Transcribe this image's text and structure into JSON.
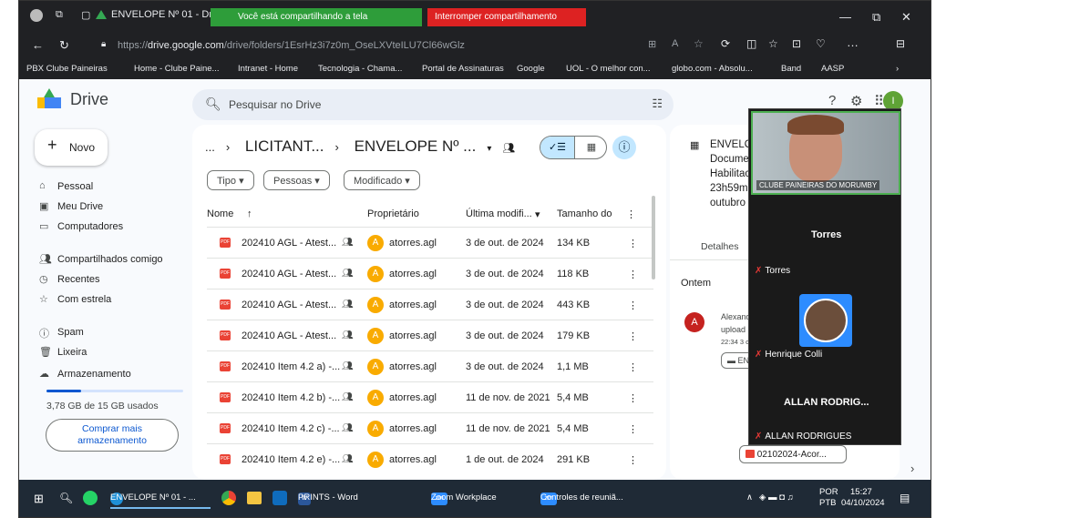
{
  "browser": {
    "tab_title": "ENVELOPE Nº 01 - Dr",
    "share_notice": "Você está compartilhando a tela",
    "stop_share": "Interromper compartilhamento",
    "url_prefix": "https://",
    "url_host": "drive.google.com",
    "url_path": "/drive/folders/1EsrHz3i7z0m_OseLXVteILU7Cl66wGlz",
    "bookmarks": [
      "PBX Clube Paineiras",
      "Home - Clube Paine...",
      "Intranet - Home",
      "Tecnologia - Chama...",
      "Portal de Assinaturas",
      "Google",
      "UOL - O melhor con...",
      "globo.com - Absolu...",
      "Band",
      "AASP"
    ]
  },
  "drive": {
    "app_name": "Drive",
    "search_placeholder": "Pesquisar no Drive",
    "account_initial": "I",
    "new_label": "Novo",
    "nav": [
      "Pessoal",
      "Meu Drive",
      "Computadores",
      "Compartilhados comigo",
      "Recentes",
      "Com estrela",
      "Spam",
      "Lixeira",
      "Armazenamento"
    ],
    "storage_used": 0.25,
    "storage_text": "3,78 GB de 15 GB usados",
    "buy_storage": "Comprar mais armazenamento",
    "breadcrumb": [
      "...",
      "LICITANT...",
      "ENVELOPE Nº ..."
    ],
    "filters": [
      "Tipo",
      "Pessoas",
      "Modificado"
    ],
    "columns": [
      "Nome",
      "Proprietário",
      "Última modifi...",
      "Tamanho do"
    ],
    "files": [
      {
        "name": "202410 AGL - Atest...",
        "owner": "atorres.agl",
        "modified": "3 de out. de 2024",
        "size": "134 KB"
      },
      {
        "name": "202410 AGL - Atest...",
        "owner": "atorres.agl",
        "modified": "3 de out. de 2024",
        "size": "118 KB"
      },
      {
        "name": "202410 AGL - Atest...",
        "owner": "atorres.agl",
        "modified": "3 de out. de 2024",
        "size": "443 KB"
      },
      {
        "name": "202410 AGL - Atest...",
        "owner": "atorres.agl",
        "modified": "3 de out. de 2024",
        "size": "179 KB"
      },
      {
        "name": "202410 Item 4.2 a) -...",
        "owner": "atorres.agl",
        "modified": "3 de out. de 2024",
        "size": "1,1 MB"
      },
      {
        "name": "202410 Item 4.2 b) -...",
        "owner": "atorres.agl",
        "modified": "11 de nov. de 2021",
        "size": "5,4 MB"
      },
      {
        "name": "202410 Item 4.2 c) -...",
        "owner": "atorres.agl",
        "modified": "11 de nov. de 2021",
        "size": "5,4 MB"
      },
      {
        "name": "202410 Item 4.2 e) -...",
        "owner": "atorres.agl",
        "modified": "1 de out. de 2024",
        "size": "291 KB"
      }
    ],
    "owner_initial": "A",
    "details": {
      "title_lines": [
        "ENVELO",
        "Docume",
        "Habilitac",
        "23h59m",
        "outubro"
      ],
      "tab": "Detalhes",
      "section": "Ontem",
      "activity_initial": "A",
      "activity_lines": [
        "Alexand",
        "upload",
        "22:34 3 c"
      ],
      "folder": "EN",
      "file_chip": "02102024-Acor..."
    }
  },
  "zoom": {
    "room_label": "CLUBE PAINEIRAS DO MORUMBY",
    "participants": [
      "Torres",
      "Torres",
      "Henrique Colli",
      "ALLAN RODRIG...",
      "ALLAN RODRIGUES"
    ]
  },
  "taskbar": {
    "items": [
      "ENVELOPE Nº 01 - ...",
      "PRINTS - Word",
      "Zoom Workplace",
      "Controles de reuniã..."
    ],
    "lang": "POR",
    "lang2": "PTB",
    "time": "15:27",
    "date": "04/10/2024"
  }
}
